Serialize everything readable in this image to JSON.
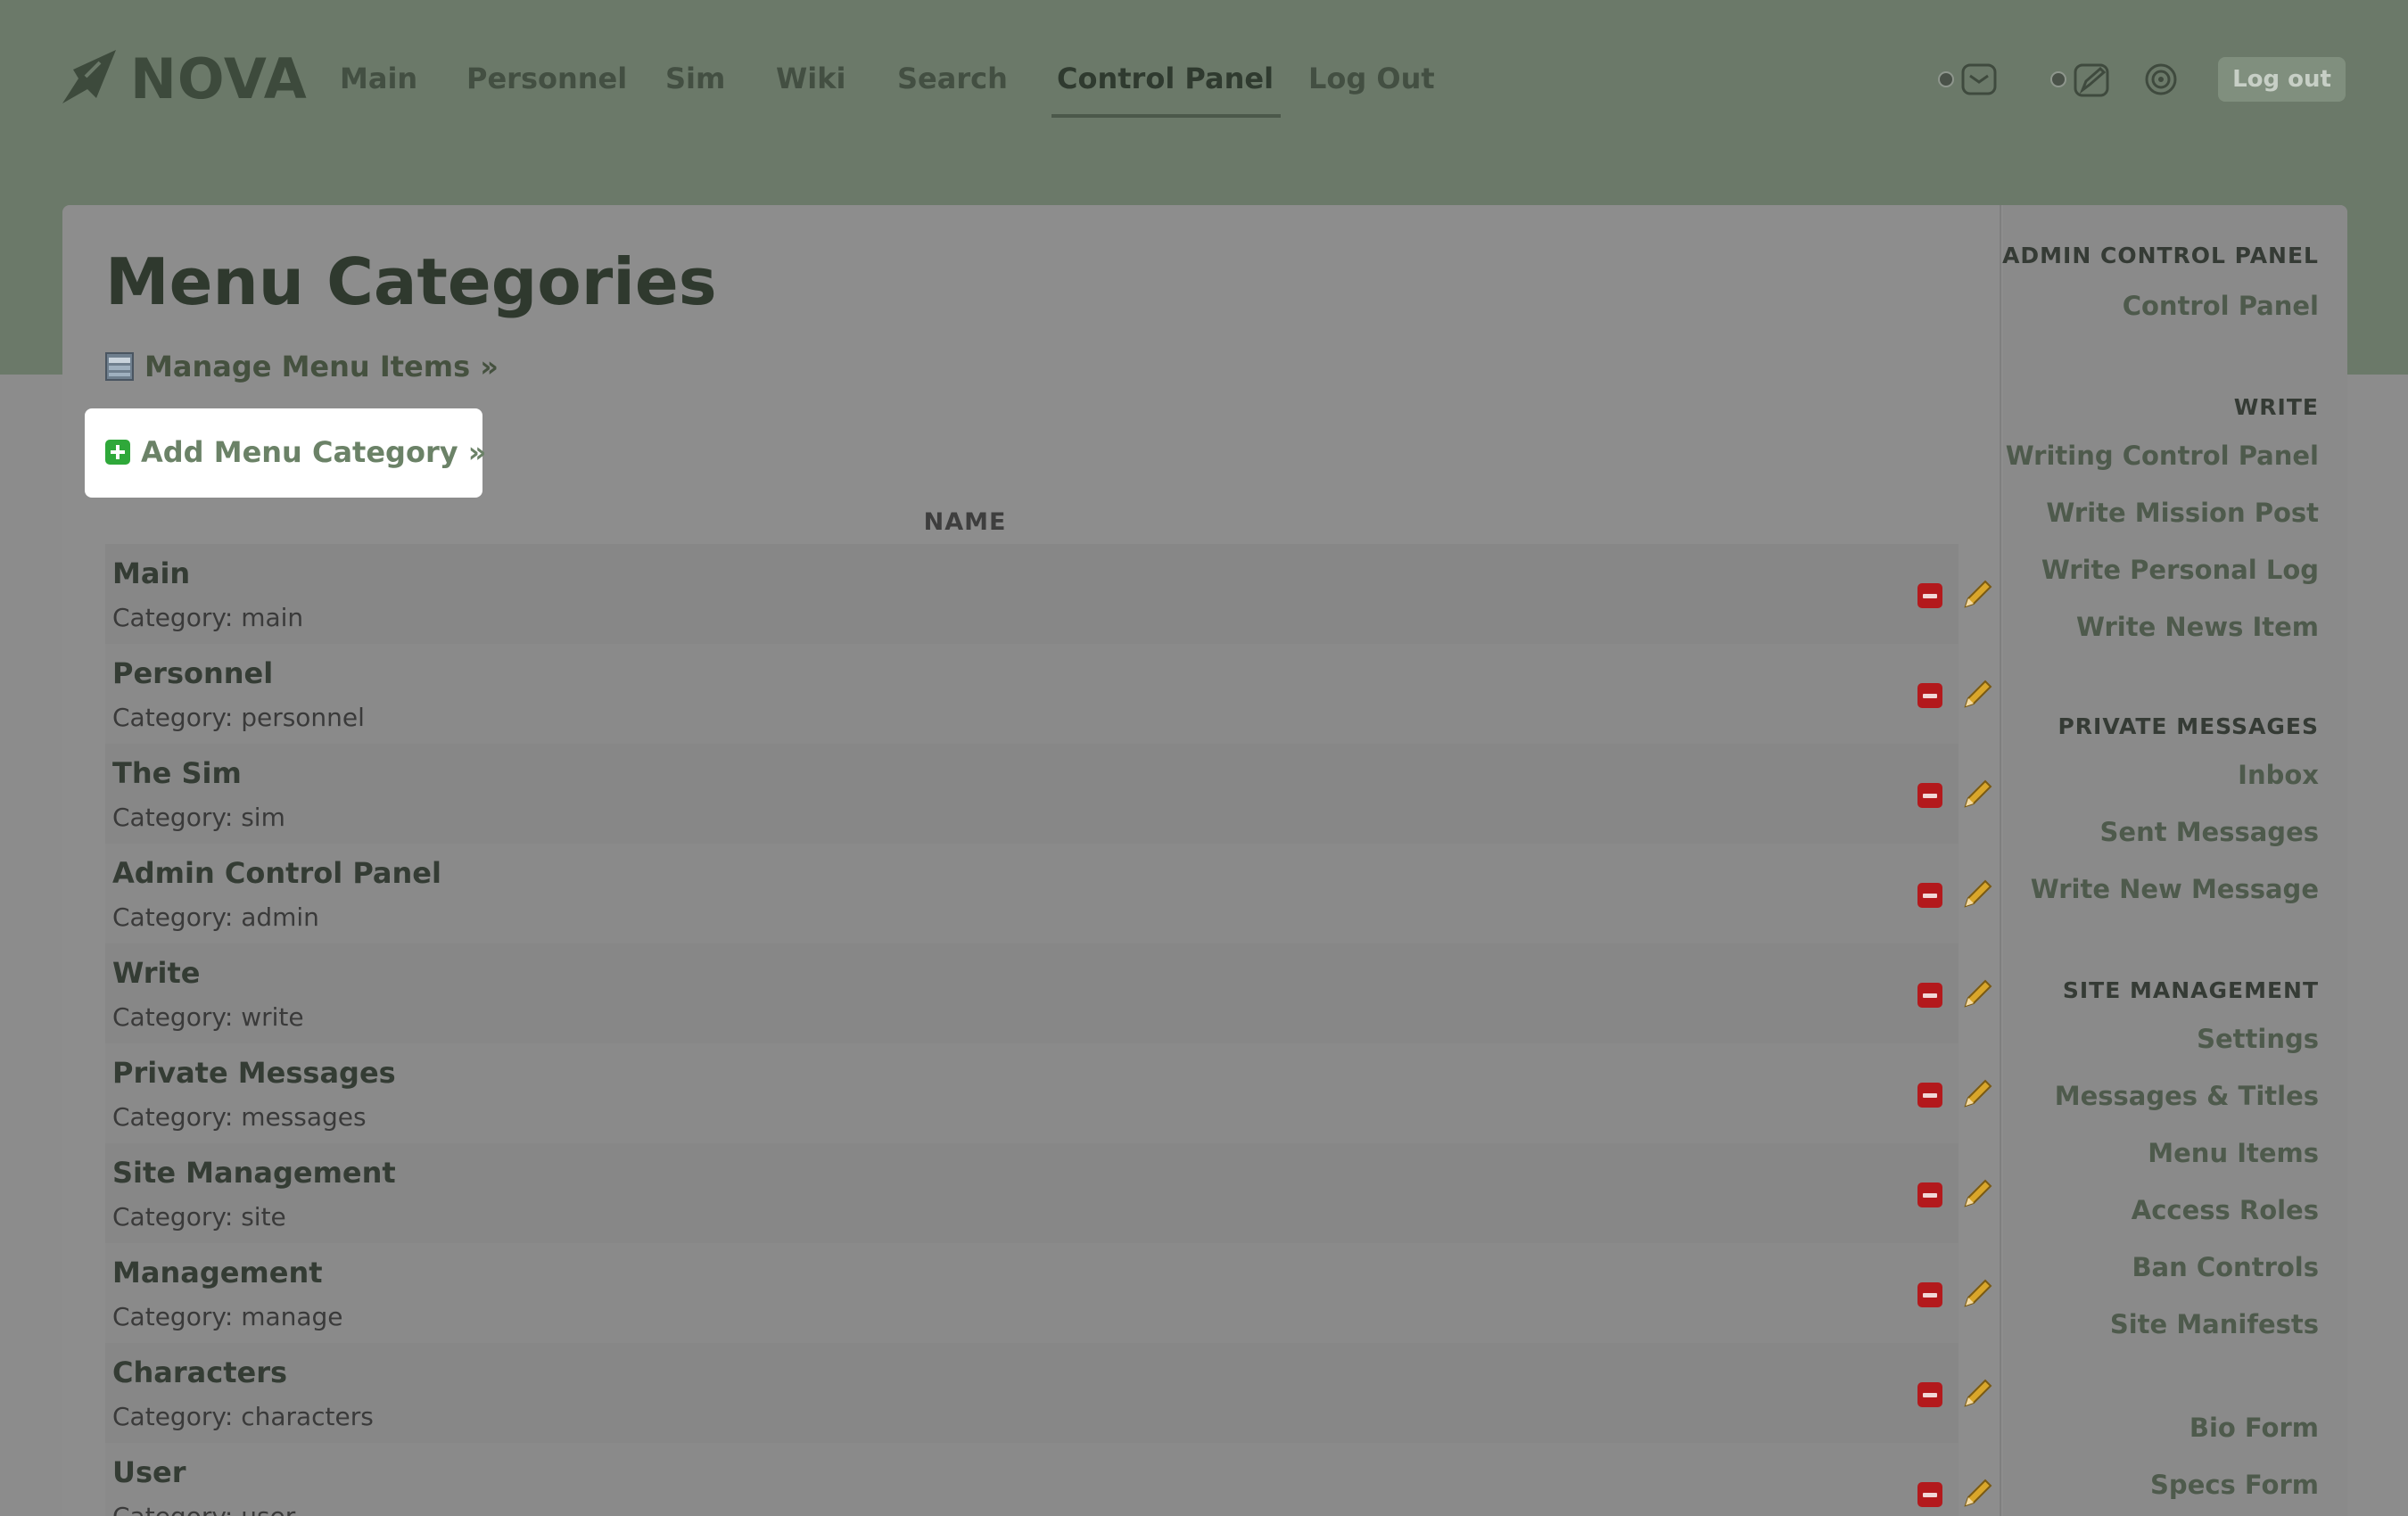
{
  "app": {
    "logo_text": "NOVA"
  },
  "nav": {
    "items": [
      {
        "label": "Main"
      },
      {
        "label": "Personnel"
      },
      {
        "label": "Sim"
      },
      {
        "label": "Wiki"
      },
      {
        "label": "Search"
      },
      {
        "label": "Control Panel",
        "active": true
      },
      {
        "label": "Log Out"
      }
    ]
  },
  "user_tools": {
    "icons": [
      "inbox-icon",
      "write-icon",
      "settings-dial-icon"
    ],
    "logout_label": "Log out"
  },
  "page": {
    "title": "Menu Categories",
    "manage_link": "Manage Menu Items »",
    "add_link": "Add Menu Category »",
    "column_header": "NAME"
  },
  "categories": [
    {
      "name": "Main",
      "category": "Category: main"
    },
    {
      "name": "Personnel",
      "category": "Category: personnel"
    },
    {
      "name": "The Sim",
      "category": "Category: sim"
    },
    {
      "name": "Admin Control Panel",
      "category": "Category: admin"
    },
    {
      "name": "Write",
      "category": "Category: write"
    },
    {
      "name": "Private Messages",
      "category": "Category: messages"
    },
    {
      "name": "Site Management",
      "category": "Category: site"
    },
    {
      "name": "Management",
      "category": "Category: manage"
    },
    {
      "name": "Characters",
      "category": "Category: characters"
    },
    {
      "name": "User",
      "category": "Category: user"
    }
  ],
  "sidebar": {
    "sections": [
      {
        "heading": "ADMIN CONTROL PANEL",
        "links": [
          "Control Panel"
        ]
      },
      {
        "heading": "WRITE",
        "links": [
          "Writing Control Panel",
          "Write Mission Post",
          "Write Personal Log",
          "Write News Item"
        ]
      },
      {
        "heading": "PRIVATE MESSAGES",
        "links": [
          "Inbox",
          "Sent Messages",
          "Write New Message"
        ]
      },
      {
        "heading": "SITE MANAGEMENT",
        "links": [
          "Settings",
          "Messages & Titles",
          "Menu Items",
          "Access Roles",
          "Ban Controls",
          "Site Manifests"
        ]
      },
      {
        "heading": "",
        "links": [
          "Bio Form",
          "Specs Form"
        ]
      }
    ]
  },
  "colors": {
    "header_bg": "#6b7969",
    "overlay_bg": "#8c8c8c",
    "delete_red": "#b3191c",
    "add_green": "#2fa83a",
    "highlight": "#ffffff"
  }
}
